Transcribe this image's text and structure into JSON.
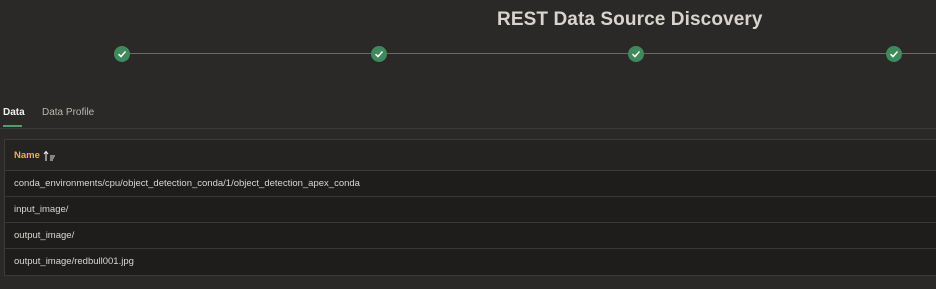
{
  "header": {
    "title": "REST Data Source Discovery"
  },
  "wizard": {
    "steps": [
      "complete",
      "complete",
      "complete",
      "complete"
    ]
  },
  "tabs": [
    {
      "label": "Data",
      "active": true
    },
    {
      "label": "Data Profile",
      "active": false
    }
  ],
  "grid": {
    "columns": [
      {
        "label": "Name",
        "sort": "ascending"
      }
    ],
    "rows": [
      "conda_environments/cpu/object_detection_conda/1/object_detection_apex_conda",
      "input_image/",
      "output_image/",
      "output_image/redbull001.jpg"
    ]
  },
  "colors": {
    "accent": "#e7b24a",
    "step": "#3d8a5a",
    "tab_underline": "#4f9d72"
  }
}
